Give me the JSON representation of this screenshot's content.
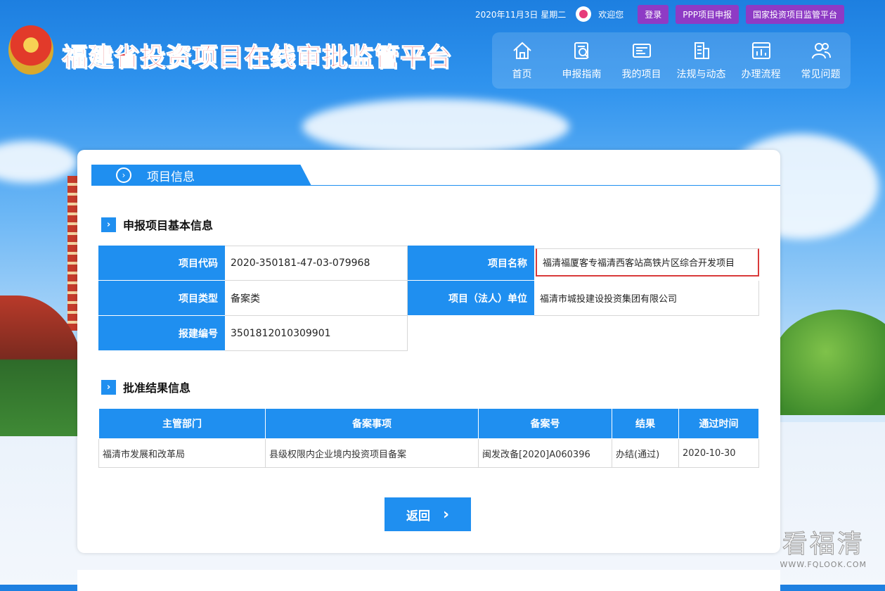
{
  "header": {
    "date": "2020年11月3日 星期二",
    "welcome": "欢迎您",
    "login_label": "登录",
    "ppp_label": "PPP项目申报",
    "national_label": "国家投资项目监管平台",
    "site_title": "福建省投资项目在线审批监管平台"
  },
  "nav": {
    "items": [
      {
        "label": "首页",
        "icon": "home-icon"
      },
      {
        "label": "申报指南",
        "icon": "guide-icon"
      },
      {
        "label": "我的项目",
        "icon": "project-icon"
      },
      {
        "label": "法规与动态",
        "icon": "building-icon"
      },
      {
        "label": "办理流程",
        "icon": "process-icon"
      },
      {
        "label": "常见问题",
        "icon": "users-icon"
      }
    ]
  },
  "panel": {
    "tab_title": "项目信息",
    "basic_section_title": "申报项目基本信息",
    "result_section_title": "批准结果信息",
    "back_label": "返回"
  },
  "basic_info": {
    "code_label": "项目代码",
    "code_value": "2020-350181-47-03-079968",
    "name_label": "项目名称",
    "name_value": "福清福厦客专福清西客站高铁片区综合开发项目",
    "type_label": "项目类型",
    "type_value": "备案类",
    "unit_label": "项目（法人）单位",
    "unit_value": "福清市城投建设投资集团有限公司",
    "build_no_label": "报建编号",
    "build_no_value": "3501812010309901"
  },
  "result_table": {
    "headers": [
      "主管部门",
      "备案事项",
      "备案号",
      "结果",
      "通过时间"
    ],
    "rows": [
      [
        "福清市发展和改革局",
        "县级权限内企业境内投资项目备案",
        "闽发改备[2020]A060396",
        "办结(通过)",
        "2020-10-30"
      ]
    ]
  },
  "watermark": {
    "text": "看福清",
    "url": "WWW.FQLOOK.COM"
  },
  "colors": {
    "primary": "#1f8ff0",
    "purple_button": "#8e3bc5",
    "title_red": "#e0242a",
    "highlight_red": "#d93a3a"
  }
}
